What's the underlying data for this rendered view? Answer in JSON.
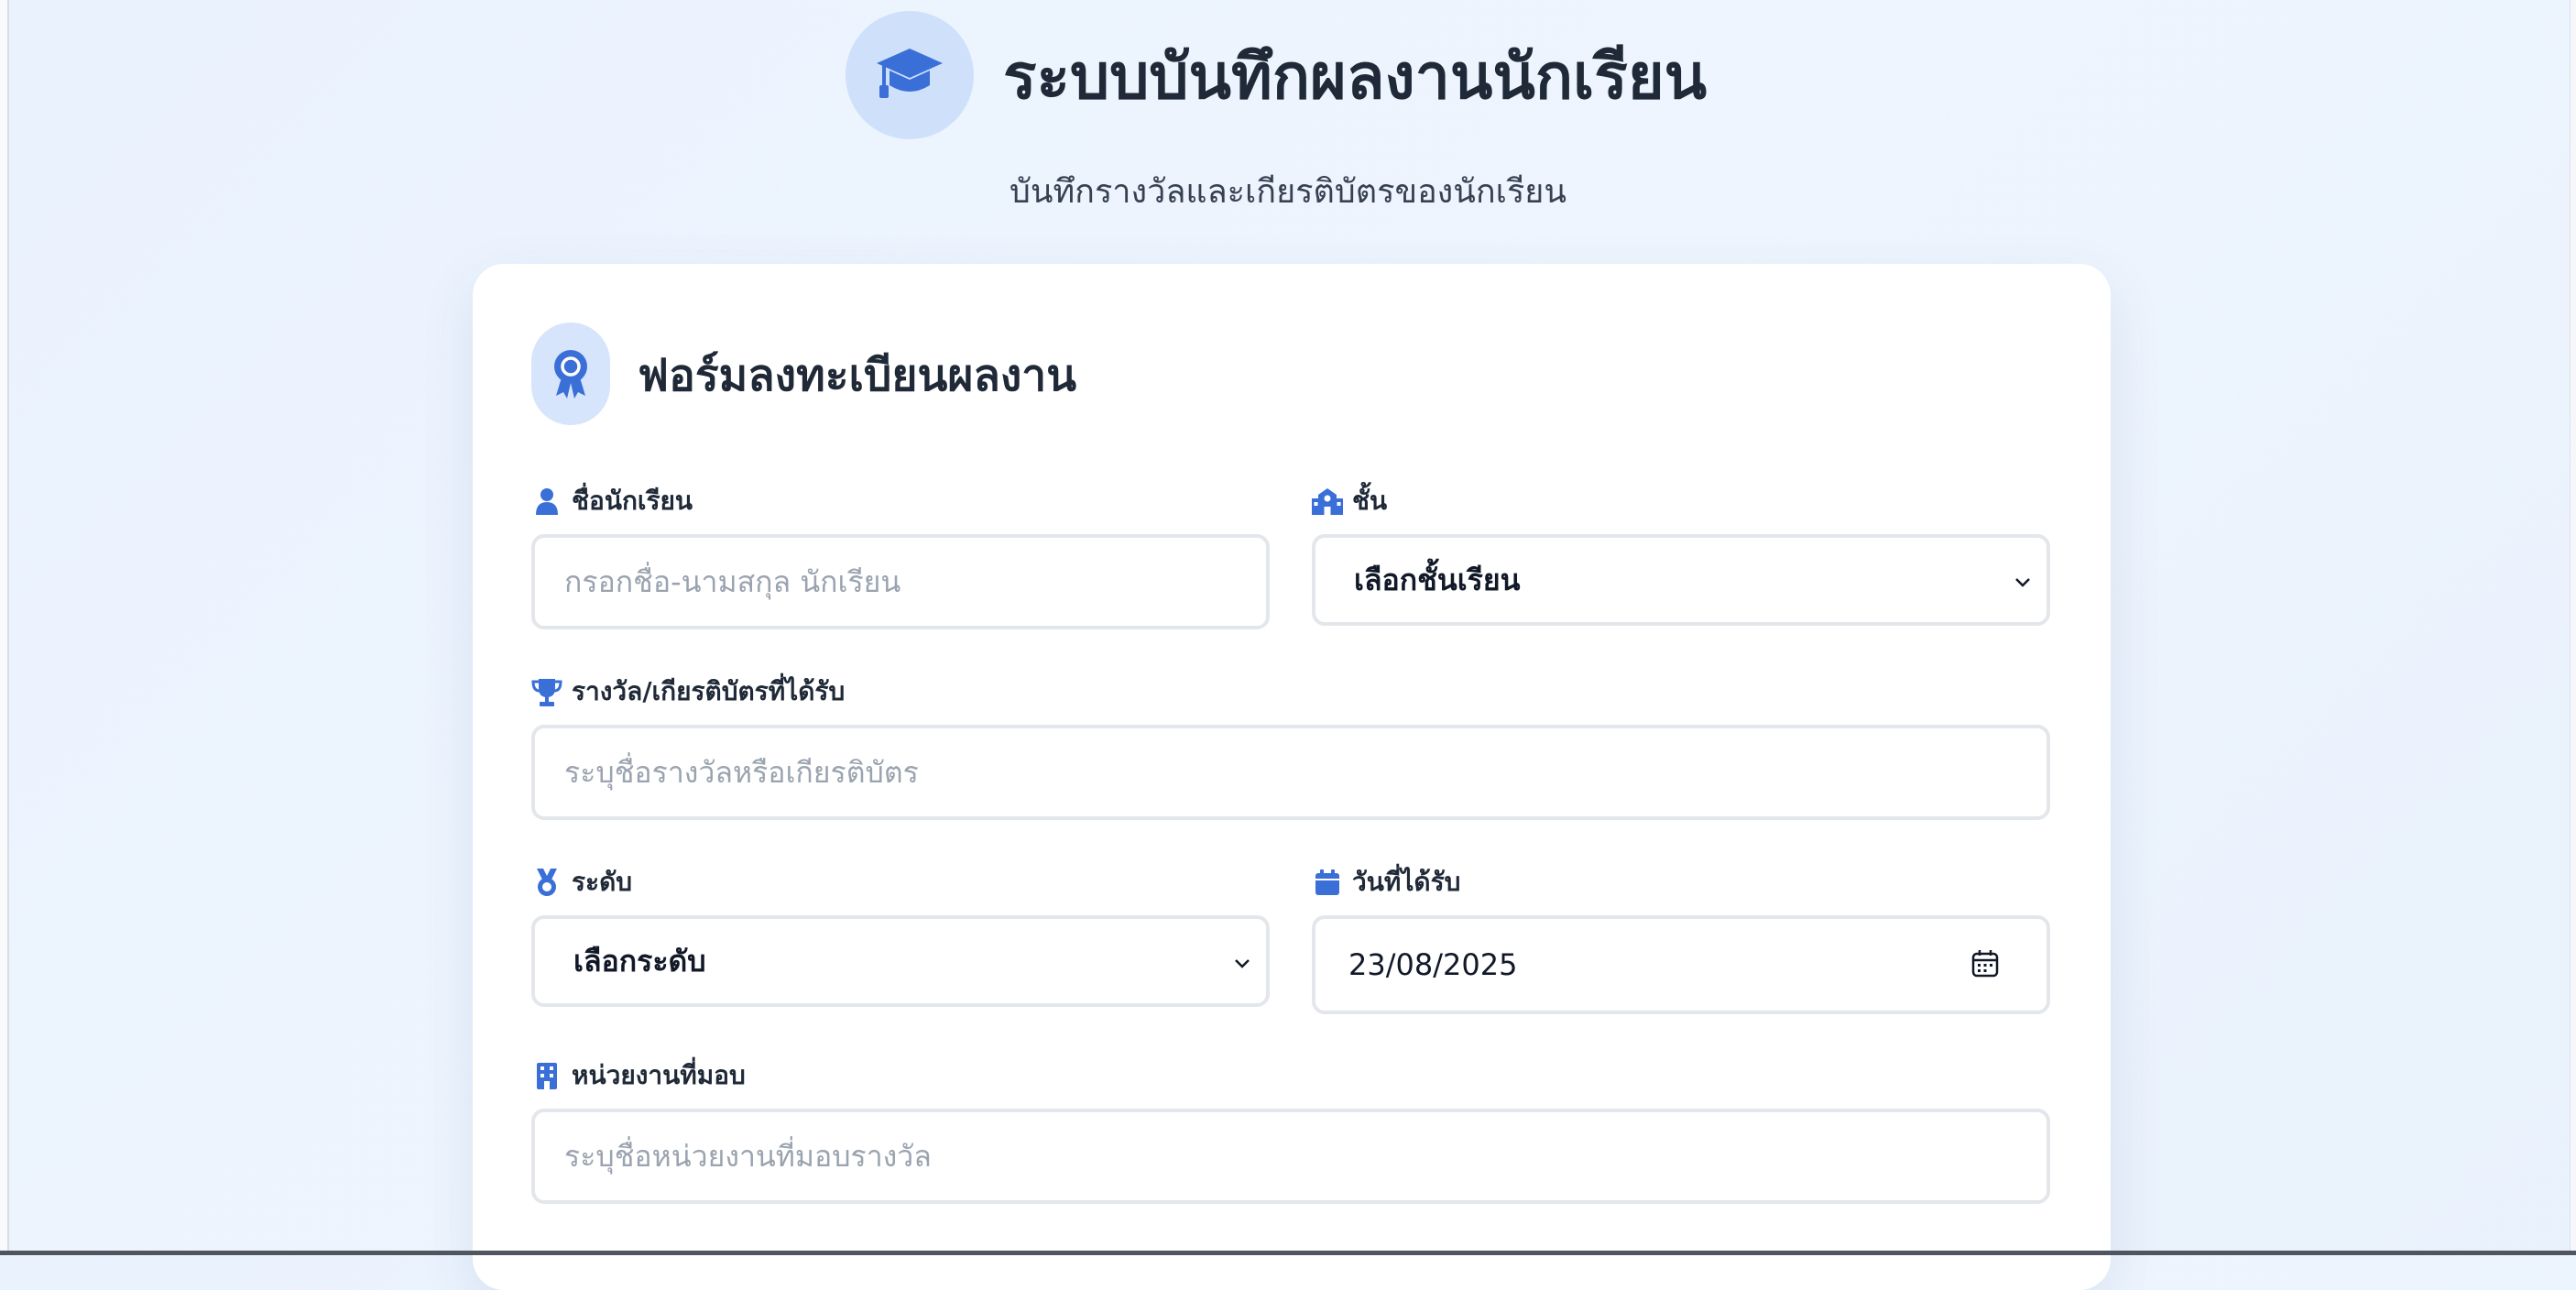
{
  "header": {
    "title": "ระบบบันทึกผลงานนักเรียน",
    "subtitle": "บันทึกรางวัลและเกียรติบัตรของนักเรียน",
    "logo_icon": "graduation-cap-icon"
  },
  "colors": {
    "accent": "#3b6fd8",
    "icon_bg": "#d6e5fc",
    "border": "#e3e6ea"
  },
  "form": {
    "title": "ฟอร์มลงทะเบียนผลงาน",
    "title_icon": "award-icon",
    "student_name": {
      "label": "ชื่อนักเรียน",
      "icon": "user-icon",
      "placeholder": "กรอกชื่อ-นามสกุล นักเรียน"
    },
    "grade": {
      "label": "ชั้น",
      "icon": "school-icon",
      "selected": "เลือกชั้นเรียน"
    },
    "award": {
      "label": "รางวัล/เกียรติบัตรที่ได้รับ",
      "icon": "trophy-icon",
      "placeholder": "ระบุชื่อรางวัลหรือเกียรติบัตร"
    },
    "level": {
      "label": "ระดับ",
      "icon": "medal-icon",
      "selected": "เลือกระดับ"
    },
    "date": {
      "label": "วันที่ได้รับ",
      "icon": "calendar-icon",
      "value": "23/08/2025"
    },
    "organization": {
      "label": "หน่วยงานที่มอบ",
      "icon": "building-icon",
      "placeholder": "ระบุชื่อหน่วยงานที่มอบรางวัล"
    }
  }
}
